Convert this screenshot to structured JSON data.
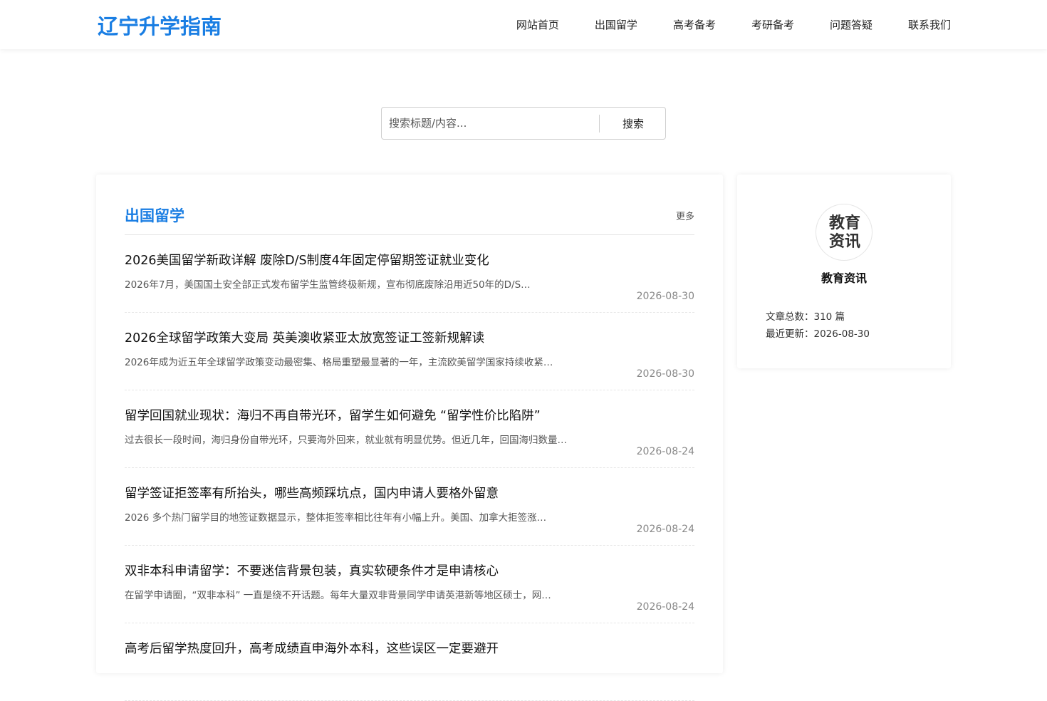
{
  "header": {
    "logo": "辽宁升学指南",
    "nav": [
      "网站首页",
      "出国留学",
      "高考备考",
      "考研备考",
      "问题答疑",
      "联系我们"
    ]
  },
  "search": {
    "placeholder": "搜索标题/内容...",
    "button_label": "搜索"
  },
  "section": {
    "title": "出国留学",
    "more_label": "更多",
    "articles": [
      {
        "title": "2026美国留学新政详解 废除D/S制度4年固定停留期签证就业变化",
        "summary": "2026年7月，美国国土安全部正式发布留学生监管终极新规，宣布彻底废除沿用近50年的D/S…",
        "date": "2026-08-30"
      },
      {
        "title": "2026全球留学政策大变局 英美澳收紧亚太放宽签证工签新规解读",
        "summary": "2026年成为近五年全球留学政策变动最密集、格局重塑最显著的一年，主流欧美留学国家持续收紧…",
        "date": "2026-08-30"
      },
      {
        "title": "留学回国就业现状：海归不再自带光环，留学生如何避免 “留学性价比陷阱”",
        "summary": "过去很长一段时间，海归身份自带光环，只要海外回来，就业就有明显优势。但近几年，回国海归数量…",
        "date": "2026-08-24"
      },
      {
        "title": "留学签证拒签率有所抬头，哪些高频踩坑点，国内申请人要格外留意",
        "summary": "2026 多个热门留学目的地签证数据显示，整体拒签率相比往年有小幅上升。美国、加拿大拒签涨…",
        "date": "2026-08-24"
      },
      {
        "title": "双非本科申请留学：不要迷信背景包装，真实软硬条件才是申请核心",
        "summary": "在留学申请圈，“双非本科” 一直是绕不开话题。每年大量双非背景同学申请英港新等地区硕士，网…",
        "date": "2026-08-24"
      },
      {
        "title": "高考后留学热度回升，高考成绩直申海外本科，这些误区一定要避开",
        "summary": "",
        "date": ""
      }
    ]
  },
  "sidebar": {
    "avatar_text": [
      "教育",
      "资讯"
    ],
    "name": "教育资讯",
    "article_count": "文章总数：310 篇",
    "last_update": "最近更新：2026-08-30"
  }
}
